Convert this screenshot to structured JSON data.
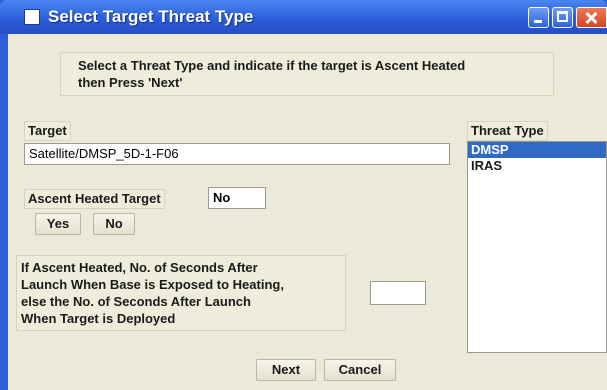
{
  "window": {
    "title": "Select Target Threat Type"
  },
  "instructions": {
    "line1": "Select a Threat Type and indicate if the target is Ascent Heated",
    "line2": "then Press 'Next'"
  },
  "target": {
    "label": "Target",
    "value": "Satellite/DMSP_5D-1-F06"
  },
  "ascent": {
    "label": "Ascent Heated Target",
    "value": "No",
    "yes_label": "Yes",
    "no_label": "No"
  },
  "seconds": {
    "lines": [
      "If Ascent Heated, No. of Seconds After",
      "Launch When Base is Exposed to Heating,",
      "else the No. of Seconds After Launch",
      "When Target is Deployed"
    ],
    "value": ""
  },
  "threat_type": {
    "label": "Threat Type",
    "items": [
      "DMSP",
      "IRAS"
    ],
    "selected": "DMSP"
  },
  "actions": {
    "next_label": "Next",
    "cancel_label": "Cancel"
  },
  "colors": {
    "titlebar": "#2a5ad8",
    "client_bg": "#ece9d8",
    "selection": "#316ac5"
  },
  "icons": {
    "app": "window-icon",
    "minimize": "minimize-icon",
    "maximize": "maximize-icon",
    "close": "close-icon"
  }
}
